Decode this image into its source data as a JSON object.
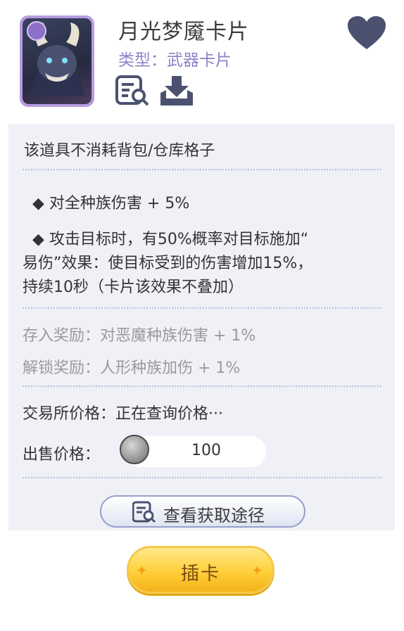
{
  "item": {
    "name": "月光梦魇卡片",
    "type": "类型：武器卡片"
  },
  "description": {
    "storage_note": "该道具不消耗背包/仓库格子",
    "effect_1": "◆  对全种族伤害 + 5%",
    "effect_2_line_1": "◆  攻击目标时，有50%概率对目标施加“",
    "effect_2_line_2": "易伤”效果：使目标受到的伤害增加15%，",
    "effect_2_line_3": "持续10秒（卡片该效果不叠加）",
    "deposit_reward": "存入奖励：对恶魔种族伤害 + 1%",
    "unlock_reward": "解锁奖励：人形种族加伤 + 1%"
  },
  "market": {
    "exchange_price": "交易所价格：正在查询价格···",
    "sell_label": "出售价格：",
    "sell_price": "100"
  },
  "buttons": {
    "view_sources": "查看获取途径",
    "insert_card": "插卡"
  },
  "colors": {
    "accent_purple": "#8a84c8",
    "panel_bg": "#f0f1f6",
    "button_gold": "#ffcf3a",
    "heart": "#4a5270"
  }
}
